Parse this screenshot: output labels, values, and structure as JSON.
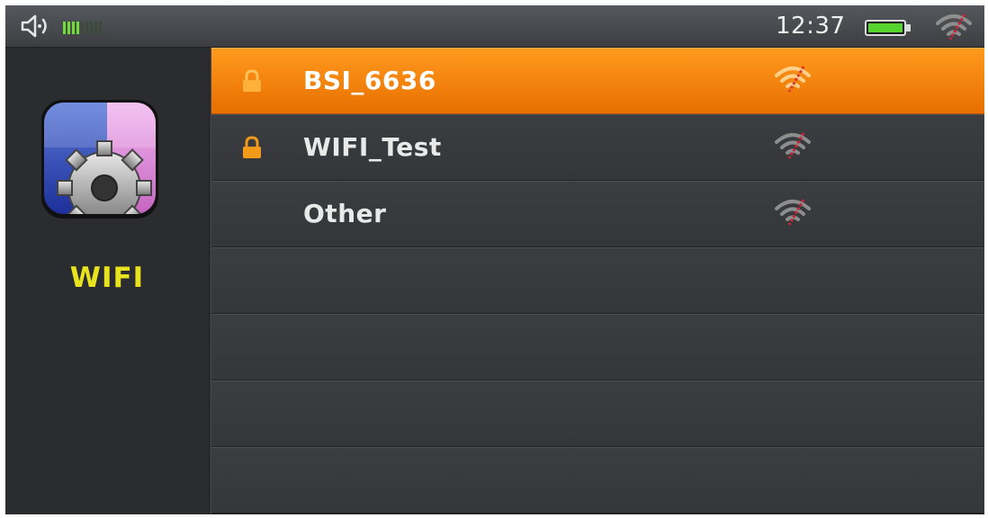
{
  "status_bar": {
    "volume_icon": "speaker-icon",
    "volume_level": {
      "filled": 4,
      "total": 9
    },
    "time": "12:37",
    "battery_icon": "battery-icon",
    "wifi_icon": "wifi-signal-icon"
  },
  "sidebar": {
    "app_icon": "settings-gear-icon",
    "app_label": "WIFI"
  },
  "networks": [
    {
      "name": "BSI_6636",
      "locked": true,
      "selected": true,
      "signal_icon": "wifi-signal-icon"
    },
    {
      "name": "WIFI_Test",
      "locked": true,
      "selected": false,
      "signal_icon": "wifi-signal-icon"
    },
    {
      "name": "Other",
      "locked": false,
      "selected": false,
      "signal_icon": "wifi-signal-icon"
    },
    {
      "name": "",
      "locked": false,
      "selected": false
    },
    {
      "name": "",
      "locked": false,
      "selected": false
    },
    {
      "name": "",
      "locked": false,
      "selected": false
    },
    {
      "name": "",
      "locked": false,
      "selected": false
    }
  ],
  "colors": {
    "accent": "#ff8a00",
    "label_yellow": "#e8e31e",
    "lock_orange": "#f29a1a",
    "volume_green": "#6fdc3a"
  }
}
